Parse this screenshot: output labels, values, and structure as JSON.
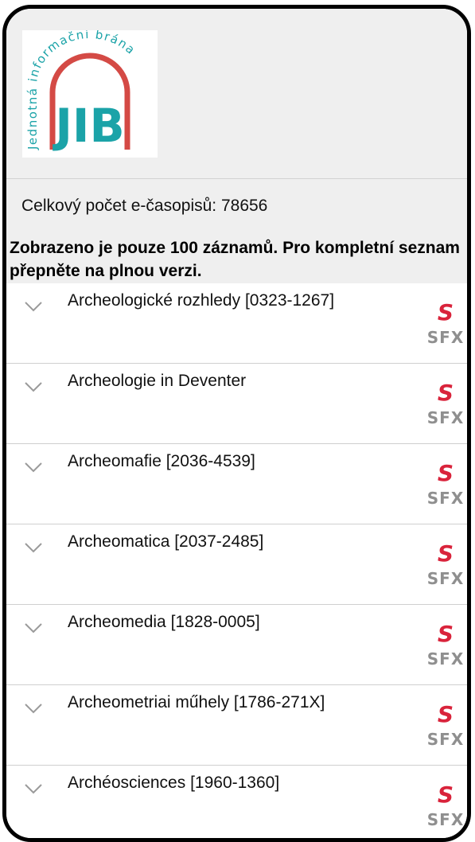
{
  "logo": {
    "text": "JIB",
    "arc_text": "Jednotná informační brána"
  },
  "info": {
    "total_label": "Celkový počet e-časopisů: 78656",
    "notice": "Zobrazeno je pouze 100 záznamů. Pro kompletní seznam přepněte na plnou verzi."
  },
  "sfx_label": "SFX",
  "sfx_symbol": "S",
  "colors": {
    "logo_teal": "#1ba3a8",
    "logo_arc": "#d44a45",
    "sfx_red": "#d9233b"
  },
  "journals": [
    {
      "title": "Archeologické rozhledy [0323-1267]"
    },
    {
      "title": "Archeologie in Deventer"
    },
    {
      "title": "Archeomafie [2036-4539]"
    },
    {
      "title": "Archeomatica [2037-2485]"
    },
    {
      "title": "Archeomedia [1828-0005]"
    },
    {
      "title": "Archeometriai műhely [1786-271X]"
    },
    {
      "title": "Archéosciences [1960-1360]"
    }
  ]
}
